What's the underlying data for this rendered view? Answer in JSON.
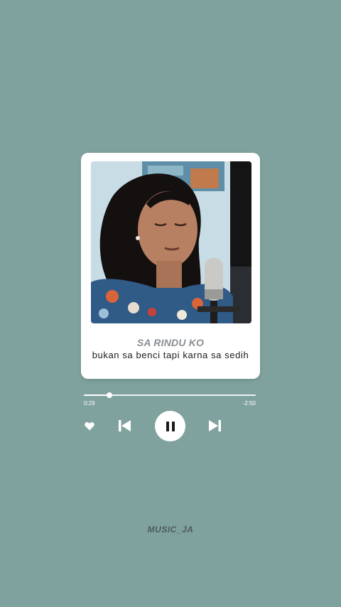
{
  "player": {
    "song_title": "SA RINDU KO",
    "lyric_line": "bukan sa benci tapi karna sa sedih",
    "elapsed": "0:29",
    "remaining": "-2:50",
    "progress_fraction": 0.15,
    "cover_icon": "album-art-photo"
  },
  "controls": {
    "like_icon": "heart-icon",
    "previous_icon": "skip-previous-icon",
    "pause_icon": "pause-icon",
    "next_icon": "skip-next-icon"
  },
  "footer": {
    "brand": "MUSIC_JA"
  },
  "colors": {
    "background": "#7fa29e",
    "card": "#ffffff",
    "title": "#8a8f94",
    "brand": "#4d5a5e"
  }
}
